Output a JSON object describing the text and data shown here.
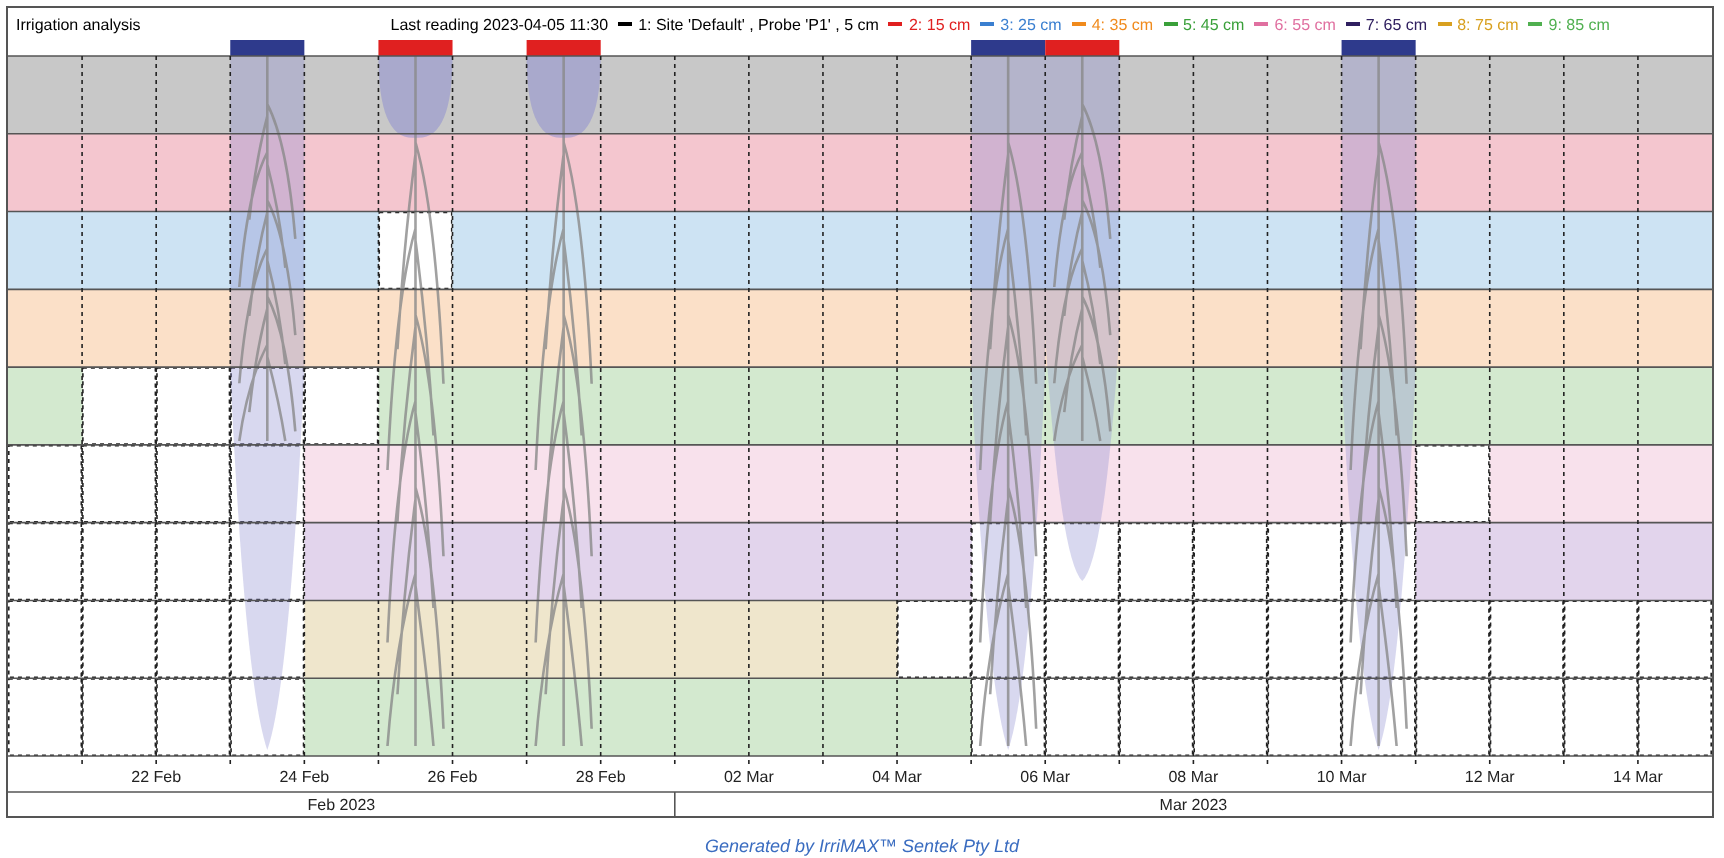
{
  "title": "Irrigation analysis",
  "legend": {
    "last_reading": "Last reading 2023-04-05 11:30",
    "series": [
      {
        "label": "1: Site 'Default' , Probe 'P1' , 5 cm",
        "color": "#000000"
      },
      {
        "label": "2: 15 cm",
        "color": "#e02020"
      },
      {
        "label": "3: 25 cm",
        "color": "#3a7fd0"
      },
      {
        "label": "4: 35 cm",
        "color": "#f08a1c"
      },
      {
        "label": "5: 45 cm",
        "color": "#3aa03a"
      },
      {
        "label": "6: 55 cm",
        "color": "#e070a0"
      },
      {
        "label": "7: 65 cm",
        "color": "#302060"
      },
      {
        "label": "8: 75 cm",
        "color": "#d8a020"
      },
      {
        "label": "9: 85 cm",
        "color": "#50b050"
      }
    ]
  },
  "bands": [
    {
      "color": "#c8c8c8"
    },
    {
      "color": "#f4c6cf"
    },
    {
      "color": "#cde3f3"
    },
    {
      "color": "#fbe0c8"
    },
    {
      "color": "#d3e9cf"
    },
    {
      "color": "#f8e1ec"
    },
    {
      "color": "#e2d4ec"
    },
    {
      "color": "#efe6cc"
    },
    {
      "color": "#d3e9cf"
    }
  ],
  "months": [
    {
      "label": "Feb 2023",
      "days": [
        {
          "wet": [
            true,
            true,
            true,
            true,
            true,
            false,
            false,
            false,
            false
          ]
        },
        {
          "wet": [
            true,
            true,
            true,
            true,
            false,
            false,
            false,
            false,
            false
          ]
        },
        {
          "tick_label": "22 Feb",
          "wet": [
            true,
            true,
            true,
            true,
            false,
            false,
            false,
            false,
            false
          ]
        },
        {
          "event": {
            "color": "#2e3a8c"
          },
          "wet": [
            true,
            true,
            true,
            true,
            false,
            false,
            false,
            false,
            false
          ],
          "plume": {
            "kind": "deep"
          },
          "roots": {
            "kind": "short"
          }
        },
        {
          "tick_label": "24 Feb",
          "wet": [
            true,
            true,
            true,
            true,
            false,
            true,
            true,
            true,
            true
          ]
        },
        {
          "event": {
            "color": "#e02020"
          },
          "wet": [
            true,
            true,
            false,
            true,
            true,
            true,
            true,
            true,
            true
          ],
          "plume": {
            "kind": "top"
          },
          "roots": {
            "kind": "long"
          }
        },
        {
          "tick_label": "26 Feb",
          "wet": [
            true,
            true,
            true,
            true,
            true,
            true,
            true,
            true,
            true
          ]
        },
        {
          "event": {
            "color": "#e02020"
          },
          "wet": [
            true,
            true,
            true,
            true,
            true,
            true,
            true,
            true,
            true
          ],
          "plume": {
            "kind": "top"
          },
          "roots": {
            "kind": "long"
          }
        },
        {
          "tick_label": "28 Feb",
          "wet": [
            true,
            true,
            true,
            true,
            true,
            true,
            true,
            true,
            true
          ]
        }
      ]
    },
    {
      "label": "Mar 2023",
      "days": [
        {
          "wet": [
            true,
            true,
            true,
            true,
            true,
            true,
            true,
            true,
            true
          ]
        },
        {
          "tick_label": "02 Mar",
          "wet": [
            true,
            true,
            true,
            true,
            true,
            true,
            true,
            true,
            true
          ]
        },
        {
          "wet": [
            true,
            true,
            true,
            true,
            true,
            true,
            true,
            true,
            true
          ]
        },
        {
          "tick_label": "04 Mar",
          "wet": [
            true,
            true,
            true,
            true,
            true,
            true,
            true,
            false,
            true
          ]
        },
        {
          "event": {
            "color": "#2e3a8c"
          },
          "wet": [
            true,
            true,
            true,
            true,
            true,
            true,
            false,
            false,
            false
          ],
          "plume": {
            "kind": "deep"
          },
          "roots": {
            "kind": "long"
          }
        },
        {
          "tick_label": "06 Mar",
          "event": {
            "color": "#e02020"
          },
          "wet": [
            true,
            true,
            true,
            true,
            true,
            true,
            false,
            false,
            false
          ],
          "plume": {
            "kind": "mid"
          },
          "roots": {
            "kind": "short"
          }
        },
        {
          "wet": [
            true,
            true,
            true,
            true,
            true,
            true,
            false,
            false,
            false
          ]
        },
        {
          "tick_label": "08 Mar",
          "wet": [
            true,
            true,
            true,
            true,
            true,
            true,
            false,
            false,
            false
          ]
        },
        {
          "wet": [
            true,
            true,
            true,
            true,
            true,
            true,
            false,
            false,
            false
          ]
        },
        {
          "tick_label": "10 Mar",
          "event": {
            "color": "#2e3a8c"
          },
          "wet": [
            true,
            true,
            true,
            true,
            true,
            true,
            false,
            false,
            false
          ],
          "plume": {
            "kind": "deep"
          },
          "roots": {
            "kind": "long"
          }
        },
        {
          "wet": [
            true,
            true,
            true,
            true,
            true,
            false,
            true,
            false,
            false
          ]
        },
        {
          "tick_label": "12 Mar",
          "wet": [
            true,
            true,
            true,
            true,
            true,
            true,
            true,
            false,
            false
          ]
        },
        {
          "wet": [
            true,
            true,
            true,
            true,
            true,
            true,
            true,
            false,
            false
          ]
        },
        {
          "tick_label": "14 Mar",
          "wet": [
            true,
            true,
            true,
            true,
            true,
            true,
            true,
            false,
            false
          ]
        }
      ]
    }
  ],
  "footer": "Generated by IrriMAX™ Sentek Pty Ltd"
}
